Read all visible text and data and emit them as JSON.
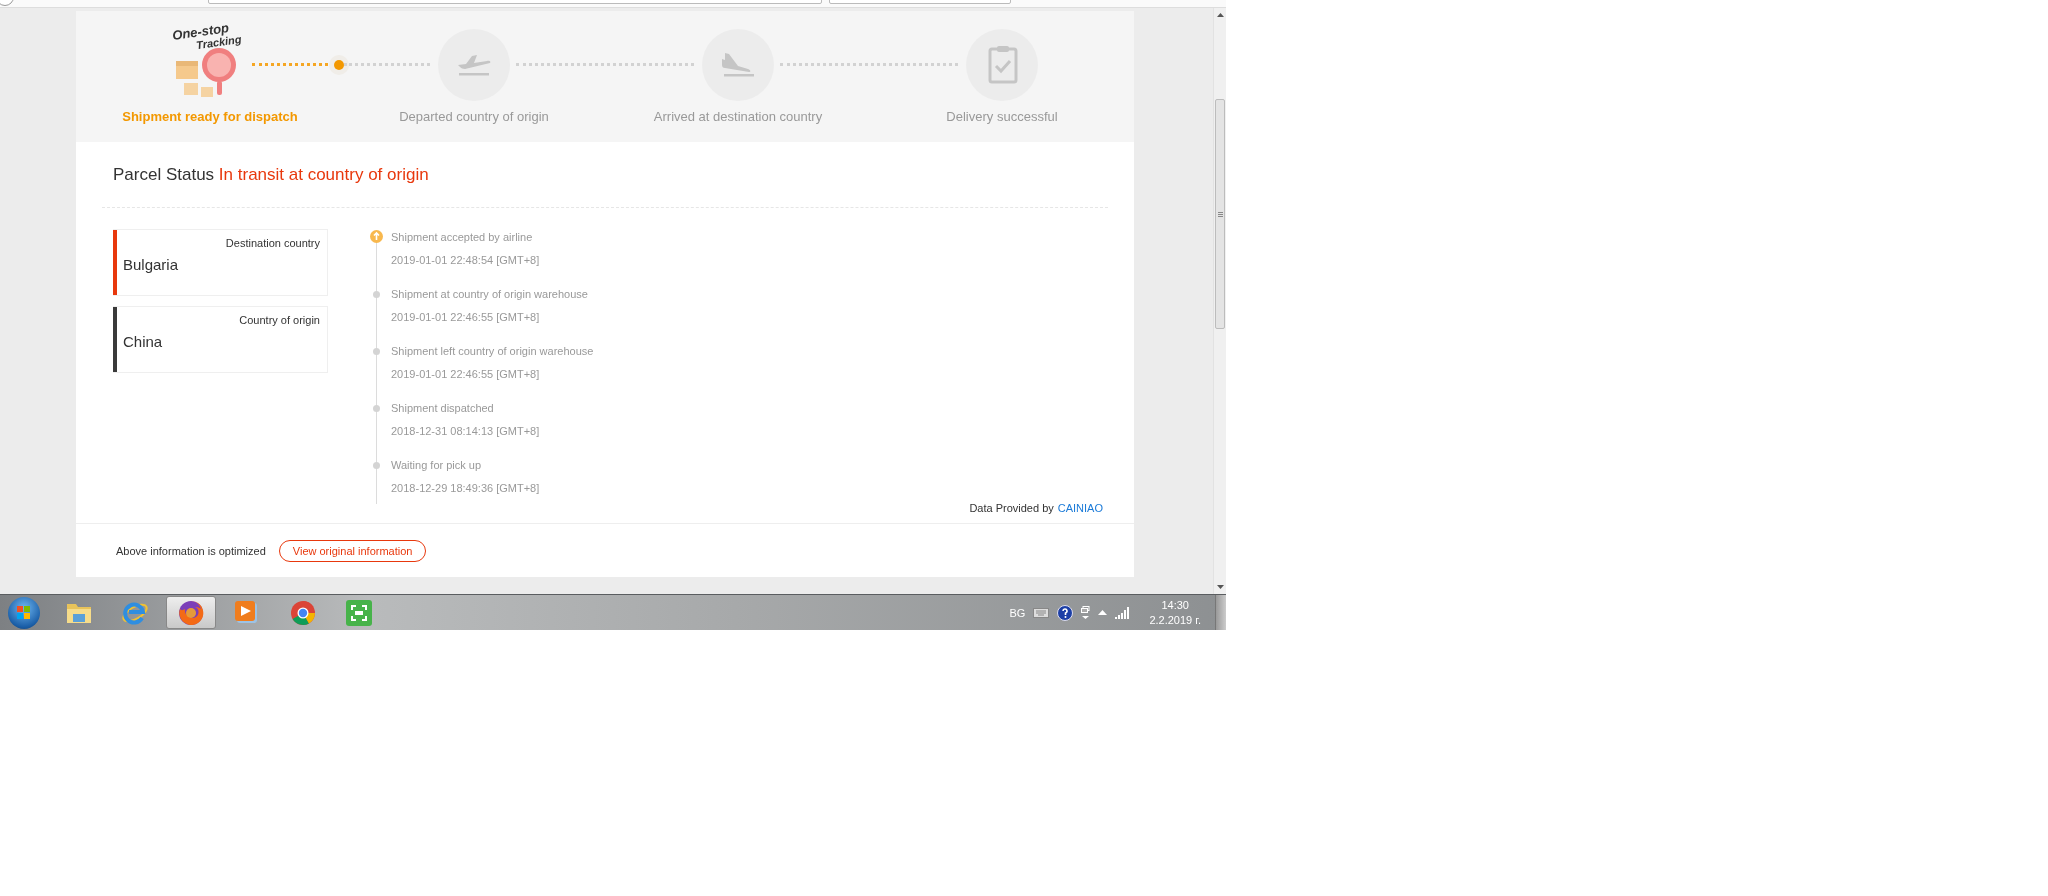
{
  "logo": {
    "line_1": "One-stop",
    "line_2": "Tracking"
  },
  "steps": [
    {
      "label": "Shipment ready for dispatch",
      "selected": true,
      "kind": "logo"
    },
    {
      "label": "Departed country of origin",
      "selected": false,
      "kind": "takeoff"
    },
    {
      "label": "Arrived at destination country",
      "selected": false,
      "kind": "landing"
    },
    {
      "label": "Delivery successful",
      "selected": false,
      "kind": "clipboard"
    }
  ],
  "parcel_status": {
    "label": "Parcel Status",
    "value": "In transit at country of origin"
  },
  "countries": [
    {
      "label": "Destination country",
      "value": "Bulgaria",
      "color": "#e8380d"
    },
    {
      "label": "Country of origin",
      "value": "China",
      "color": "#3a3a3a"
    }
  ],
  "events": [
    {
      "title": "Shipment accepted by airline",
      "time": "2019-01-01 22:48:54 [GMT+8]",
      "kind": "latest"
    },
    {
      "title": "Shipment at country of origin warehouse",
      "time": "2019-01-01 22:46:55 [GMT+8]",
      "kind": "past"
    },
    {
      "title": "Shipment left country of origin warehouse",
      "time": "2019-01-01 22:46:55 [GMT+8]",
      "kind": "past"
    },
    {
      "title": "Shipment dispatched",
      "time": "2018-12-31 08:14:13 [GMT+8]",
      "kind": "past"
    },
    {
      "title": "Waiting for pick up",
      "time": "2018-12-29 18:49:36 [GMT+8]",
      "kind": "past"
    }
  ],
  "data_provider": {
    "label": "Data Provided by",
    "link": "CAINIAO"
  },
  "footer": {
    "note": "Above information is optimized",
    "button": "View original information"
  },
  "taskbar": {
    "apps": [
      {
        "kind": "folder",
        "selected": false
      },
      {
        "kind": "ie",
        "selected": false
      },
      {
        "kind": "firefox",
        "selected": true
      },
      {
        "kind": "media",
        "selected": false
      },
      {
        "kind": "chrome",
        "selected": false
      },
      {
        "kind": "capture",
        "selected": false
      }
    ],
    "language": "BG",
    "time": "14:30",
    "date": "2.2.2019 г."
  }
}
